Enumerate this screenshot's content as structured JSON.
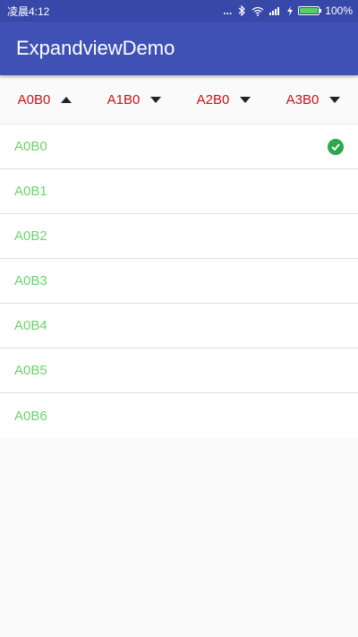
{
  "status_bar": {
    "time": "凌晨4:12",
    "dots": "...",
    "battery_text": "100%",
    "battery_level": 1.0
  },
  "app_bar": {
    "title": "ExpandviewDemo"
  },
  "tabs": [
    {
      "label": "A0B0",
      "arrow": "up"
    },
    {
      "label": "A1B0",
      "arrow": "down"
    },
    {
      "label": "A2B0",
      "arrow": "down"
    },
    {
      "label": "A3B0",
      "arrow": "down"
    }
  ],
  "list": {
    "items": [
      "A0B0",
      "A0B1",
      "A0B2",
      "A0B3",
      "A0B4",
      "A0B5",
      "A0B6"
    ],
    "selected_index": 0
  },
  "colors": {
    "app_bar": "#3f51b5",
    "status_bar": "#3848a8",
    "tab_label": "#cc1111",
    "list_text": "#6bd46b",
    "check": "#2aa84a"
  },
  "icons": [
    "bluetooth-icon",
    "wifi-icon",
    "signal-icon",
    "charging-icon",
    "battery-icon",
    "check-circle-icon"
  ]
}
